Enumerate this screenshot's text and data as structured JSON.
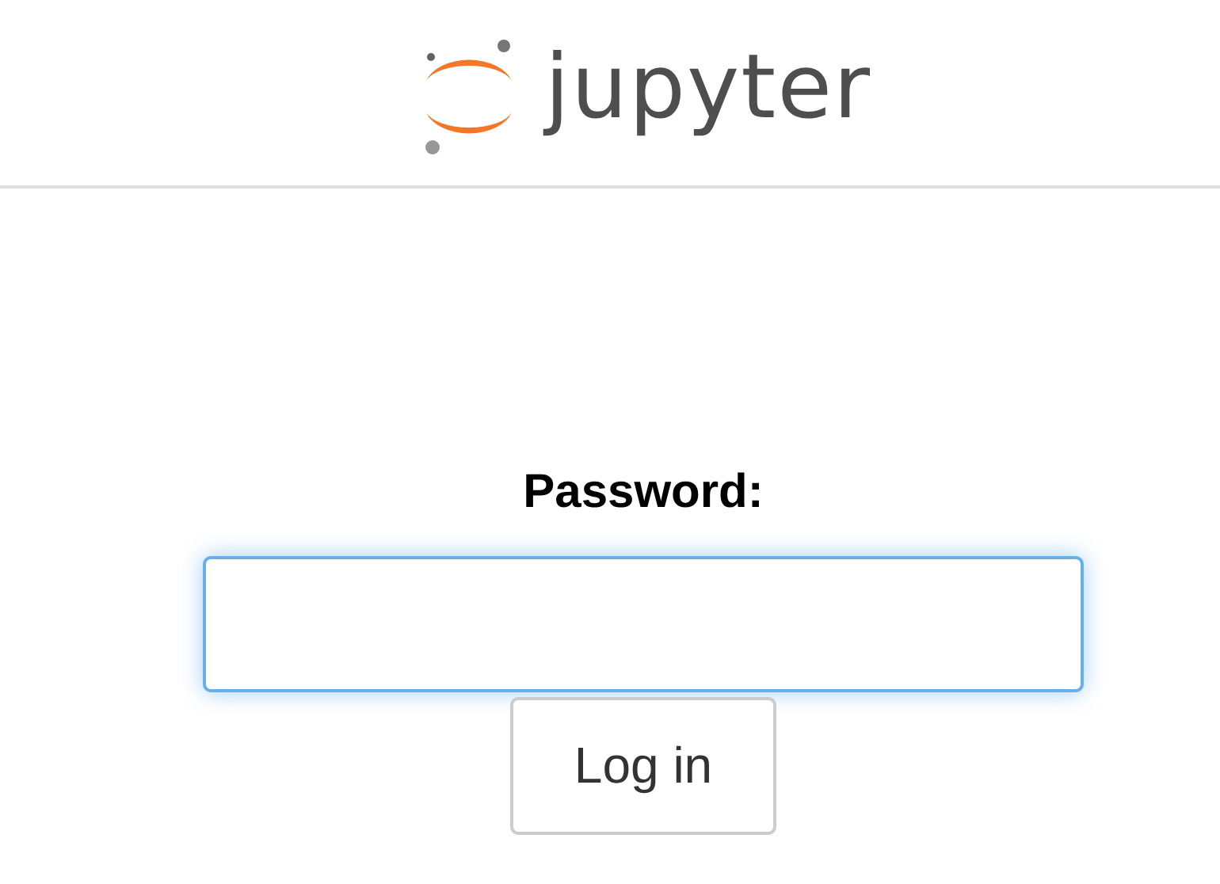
{
  "header": {
    "logo_text": "jupyter"
  },
  "login": {
    "label": "Password:",
    "button": "Log in"
  }
}
